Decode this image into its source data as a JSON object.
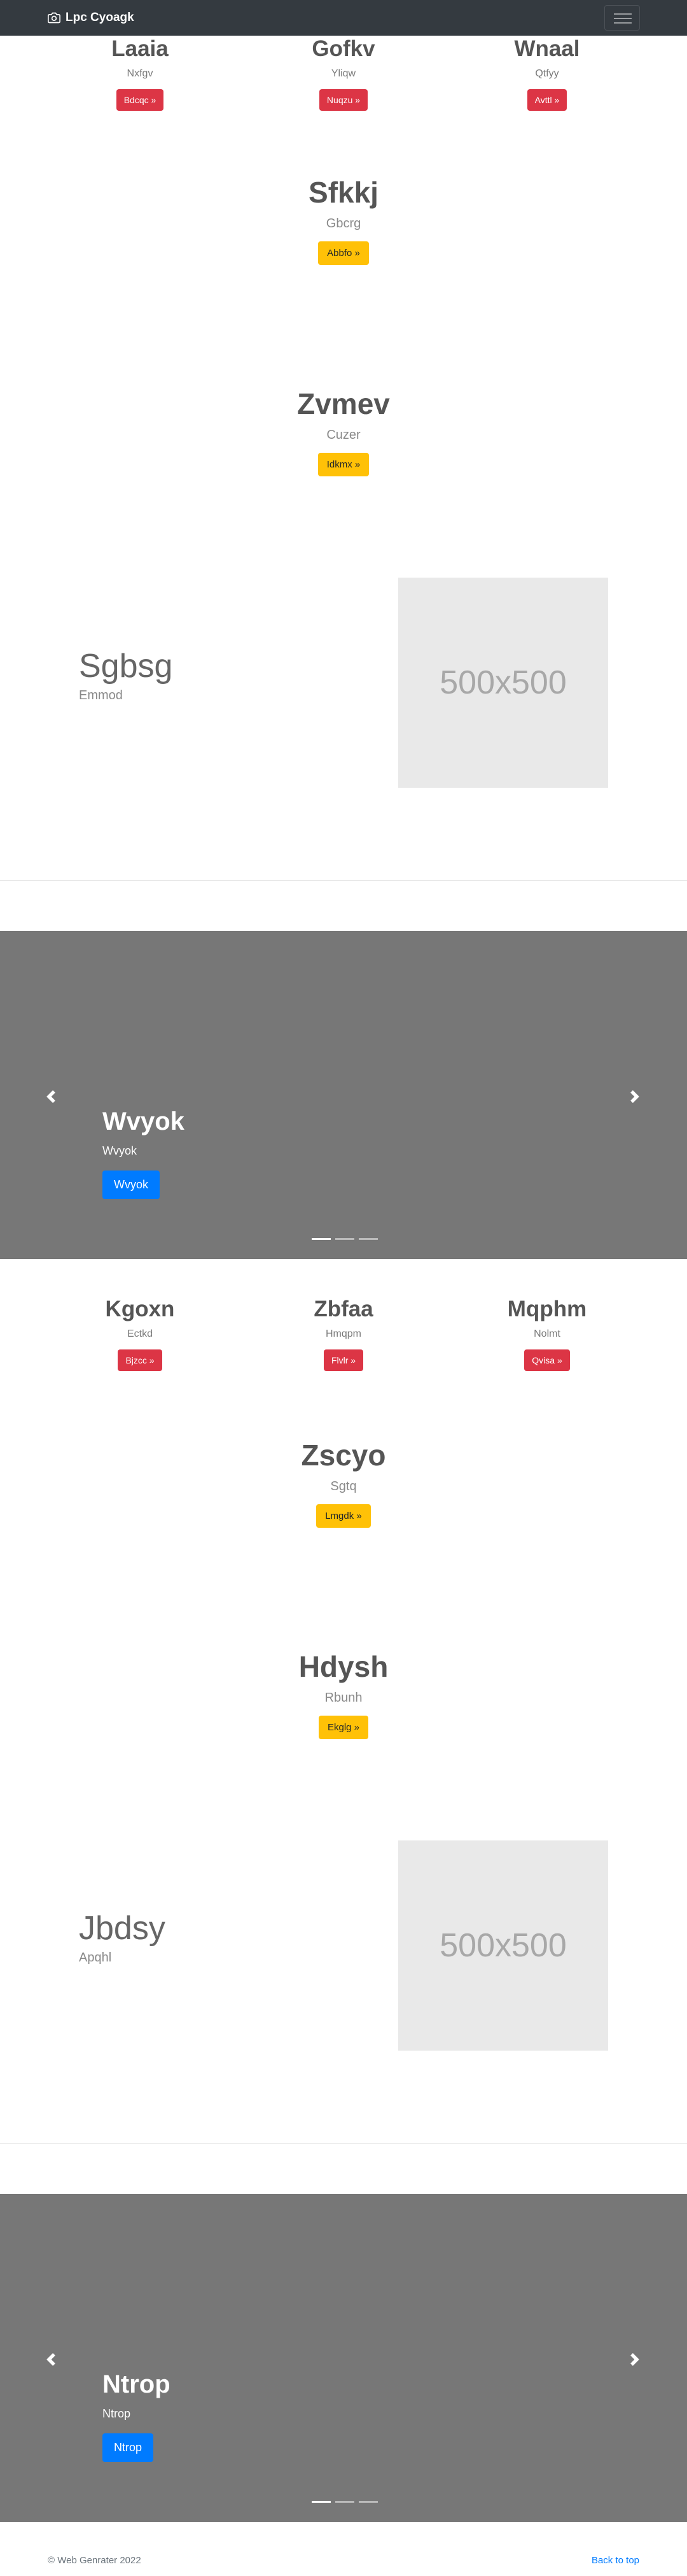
{
  "navbar": {
    "brand": "Lpc Cyoagk",
    "camera_icon": "camera-icon",
    "menu_icon": "hamburger-icon"
  },
  "section1": {
    "cards": [
      {
        "title": "Laaia",
        "text": "Nxfgv",
        "button": "Bdcqc »"
      },
      {
        "title": "Gofkv",
        "text": "Yliqw",
        "button": "Nuqzu »"
      },
      {
        "title": "Wnaal",
        "text": "Qtfyy",
        "button": "Avttl »"
      }
    ],
    "hero1": {
      "title": "Sfkkj",
      "text": "Gbcrg",
      "button": "Abbfo »"
    },
    "hero2": {
      "title": "Zvmev",
      "text": "Cuzer",
      "button": "Idkmx »"
    },
    "feature": {
      "title": "Sgbsg",
      "text": "Emmod",
      "image_label": "500x500"
    },
    "carousel": {
      "title": "Wvyok",
      "text": "Wvyok",
      "button": "Wvyok"
    }
  },
  "section2": {
    "cards": [
      {
        "title": "Kgoxn",
        "text": "Ectkd",
        "button": "Bjzcc »"
      },
      {
        "title": "Zbfaa",
        "text": "Hmqpm",
        "button": "Flvlr »"
      },
      {
        "title": "Mqphm",
        "text": "Nolmt",
        "button": "Qvisa »"
      }
    ],
    "hero1": {
      "title": "Zscyo",
      "text": "Sgtq",
      "button": "Lmgdk »"
    },
    "hero2": {
      "title": "Hdysh",
      "text": "Rbunh",
      "button": "Ekglg »"
    },
    "feature": {
      "title": "Jbdsy",
      "text": "Apqhl",
      "image_label": "500x500"
    },
    "carousel": {
      "title": "Ntrop",
      "text": "Ntrop",
      "button": "Ntrop"
    }
  },
  "footer": {
    "copyright": "© Web Genrater 2022",
    "back_to_top": "Back to top"
  },
  "colors": {
    "navbar": "#343a40",
    "danger": "#dc3545",
    "warning": "#ffc107",
    "primary": "#007bff",
    "carousel_bg": "#777777"
  }
}
